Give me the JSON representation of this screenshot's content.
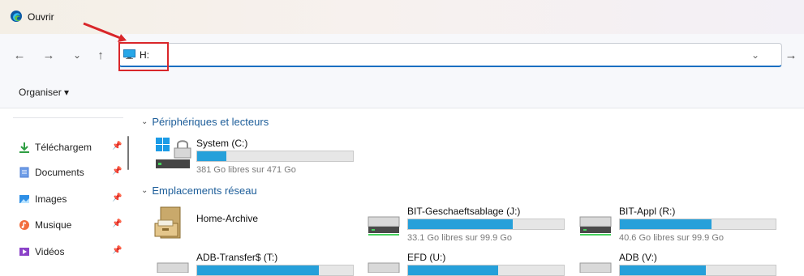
{
  "window": {
    "title": "Ouvrir"
  },
  "navigation": {
    "back_icon": "arrow-left-icon",
    "forward_icon": "arrow-right-icon",
    "recent_icon": "chevron-down-icon",
    "up_icon": "arrow-up-icon",
    "address": "H:",
    "address_icon": "computer-icon",
    "go_icon": "arrow-right-icon"
  },
  "commands": {
    "organise_label": "Organiser ▾"
  },
  "sidebar": {
    "items": [
      {
        "label": "Téléchargem",
        "icon": "download-icon",
        "pinned": true
      },
      {
        "label": "Documents",
        "icon": "documents-icon",
        "pinned": true
      },
      {
        "label": "Images",
        "icon": "pictures-icon",
        "pinned": true
      },
      {
        "label": "Musique",
        "icon": "music-icon",
        "pinned": true
      },
      {
        "label": "Vidéos",
        "icon": "videos-icon",
        "pinned": true
      }
    ]
  },
  "sections": [
    {
      "title": "Périphériques et lecteurs",
      "items": [
        {
          "name": "System (C:)",
          "space": "381 Go libres sur 471 Go",
          "used_fraction": 0.19,
          "icon": "windows-drive-icon"
        }
      ]
    },
    {
      "title": "Emplacements réseau",
      "items": [
        {
          "name": "Home-Archive",
          "space": "",
          "icon": "cabinet-icon"
        },
        {
          "name": "BIT-Geschaeftsablage (J:)",
          "space": "33.1 Go libres sur 99.9 Go",
          "used_fraction": 0.67,
          "icon": "network-drive-icon"
        },
        {
          "name": "BIT-Appl (R:)",
          "space": "40.6 Go libres sur 99.9 Go",
          "used_fraction": 0.59,
          "icon": "network-drive-icon"
        },
        {
          "name": "ADB-Transfer$ (T:)",
          "space": "",
          "used_fraction": 0.78,
          "icon": "network-drive-icon"
        },
        {
          "name": "EFD (U:)",
          "space": "",
          "used_fraction": 0.58,
          "icon": "network-drive-icon"
        },
        {
          "name": "ADB (V:)",
          "space": "",
          "used_fraction": 0.55,
          "icon": "network-drive-icon"
        }
      ]
    }
  ],
  "colors": {
    "accent": "#1a6fc2",
    "drive_fill": "#26a0da",
    "annotation": "#d9262a"
  }
}
